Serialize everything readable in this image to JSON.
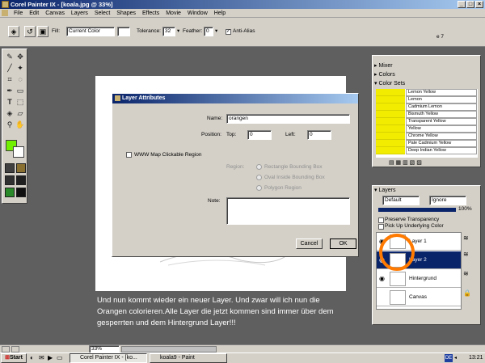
{
  "window": {
    "title": "Corel Painter IX - [koala.jpg @ 33%]"
  },
  "menu": [
    "File",
    "Edit",
    "Canvas",
    "Layers",
    "Select",
    "Shapes",
    "Effects",
    "Movie",
    "Window",
    "Help"
  ],
  "propbar": {
    "fill_label": "Fill:",
    "fill_value": "Current Color",
    "tolerance_label": "Tolerance:",
    "tolerance_value": "32",
    "feather_label": "Feather:",
    "feather_value": "0",
    "antialias_label": "Anti-Alias",
    "partial_text": "e 7"
  },
  "dialog": {
    "title": "Layer Attributes",
    "name_label": "Name:",
    "name_value": "orangen",
    "position_label": "Position:",
    "top_label": "Top:",
    "top_value": "0",
    "left_label": "Left:",
    "left_value": "0",
    "wwwmap_label": "WWW Map Clickable Region",
    "region_label": "Region:",
    "region_options": [
      "Rectangle Bounding Box",
      "Oval Inside Bounding Box",
      "Polygon Region"
    ],
    "note_label": "Note:",
    "cancel": "Cancel",
    "ok": "OK"
  },
  "caption": "Und nun kommt wieder ein neuer Layer. Und zwar will ich nun die Orangen colorieren.Alle Layer die jetzt kommen sind immer über dem gesperrten und dem Hintergrund Layer!!!",
  "panels": {
    "mixer": "Mixer",
    "colors": "Colors",
    "color_sets": "Color Sets",
    "swatches": [
      "Lemon Yellow",
      "Lemon",
      "Cadmium Lemon",
      "Bismuth Yellow",
      "Transparent Yellow",
      "Yellow",
      "Chrome Yellow",
      "Pale Cadmium Yellow",
      "Deep Indian Yellow"
    ],
    "layers_title": "Layers",
    "composite_method": "Default",
    "depth_method": "Ignore",
    "opacity": "100%",
    "preserve_transparency": "Preserve Transparency",
    "pick_up_color": "Pick Up Underlying Color",
    "layers": [
      "Layer 1",
      "Layer 2",
      "Hintergrund",
      "Canvas"
    ]
  },
  "status": {
    "zoom": "33%"
  },
  "taskbar": {
    "start": "Start",
    "tasks": [
      "Corel Painter IX - [ko...",
      "koala9 - Paint"
    ],
    "lang": "DE",
    "clock": "13:21"
  },
  "colors": {
    "swatch_yellow": "#f2ec00",
    "highlight_orange": "#ff7a00",
    "selected_layer": "#0a246a",
    "primary_color": "#70f000"
  }
}
